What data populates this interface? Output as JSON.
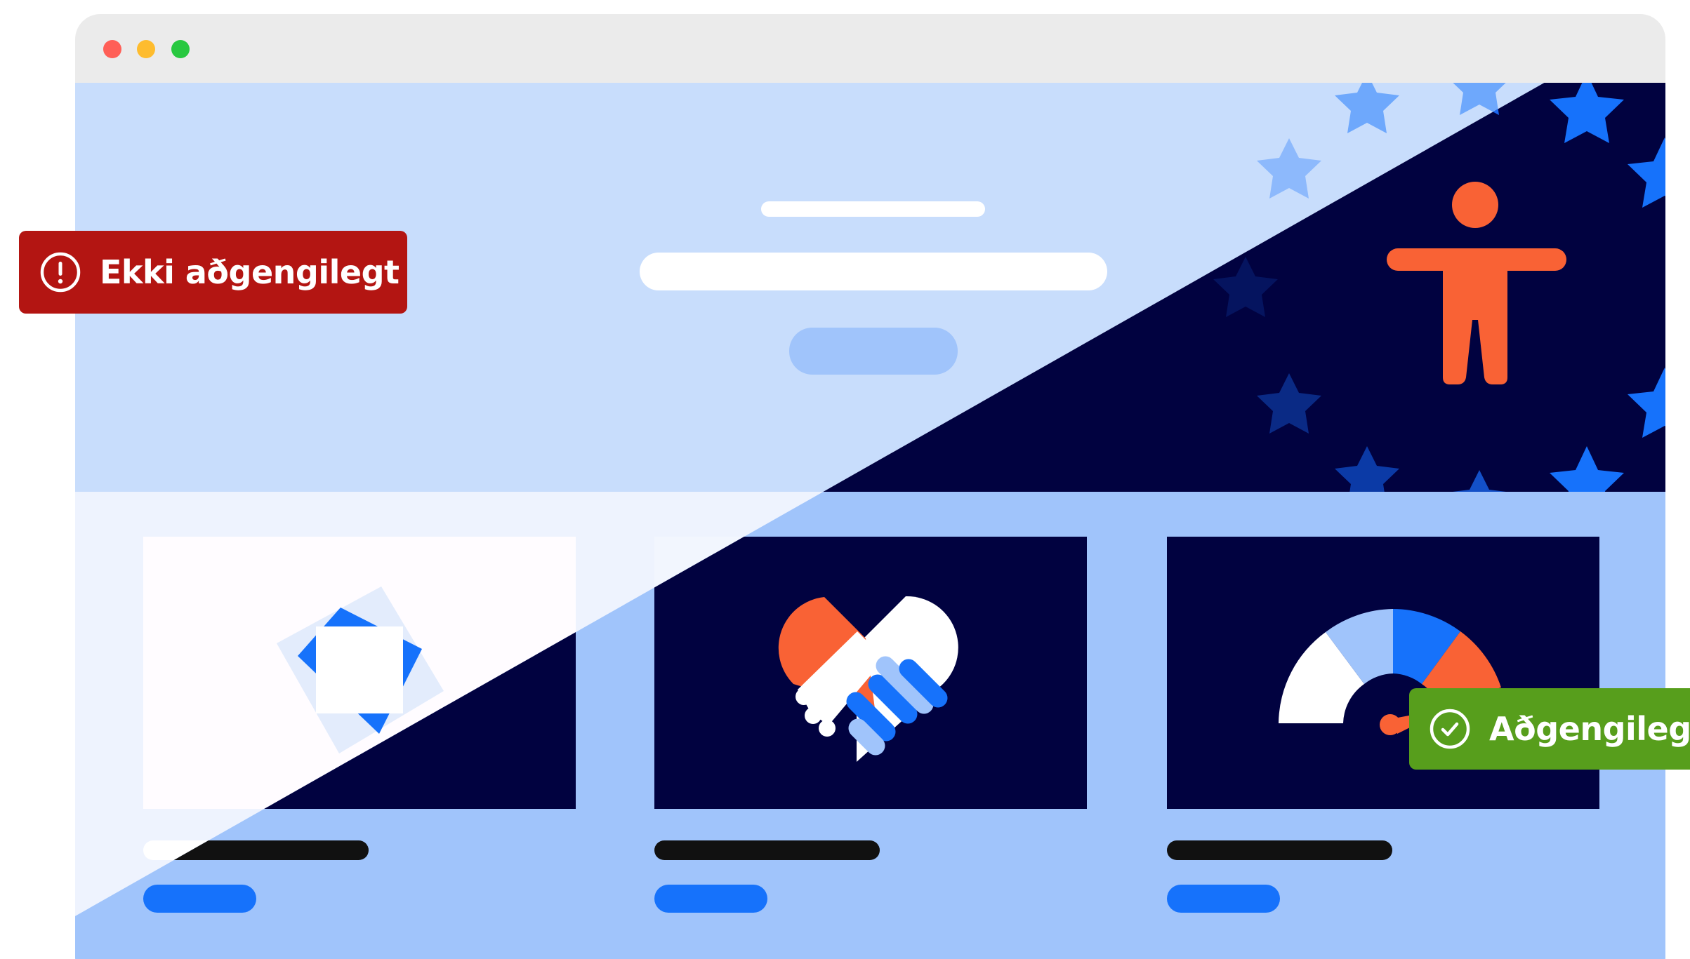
{
  "window": {
    "traffic_lights": [
      {
        "name": "close",
        "color": "#ff5f57"
      },
      {
        "name": "minimize",
        "color": "#febc2e"
      },
      {
        "name": "zoom",
        "color": "#28c840"
      }
    ]
  },
  "badges": {
    "inaccessible": {
      "label": "Ekki aðgengilegt",
      "icon": "exclamation-circle-icon",
      "color": "#b31512"
    },
    "accessible": {
      "label": "Aðgengilegt",
      "icon": "check-circle-icon",
      "color": "#579e1c"
    }
  },
  "hero": {
    "icon": "accessibility-person-icon",
    "stars_icon": "eu-stars-icon"
  },
  "cards": [
    {
      "name": "abstract-shapes",
      "icon": "overlapping-squares-icon"
    },
    {
      "name": "partnership",
      "icon": "handshake-heart-icon"
    },
    {
      "name": "performance",
      "icon": "gauge-icon"
    }
  ],
  "colors": {
    "light_background": "#c8ddfc",
    "light_content": "#eef3fe",
    "dark_background": "#010240",
    "accent_blue": "#1672fb",
    "accent_orange": "#f96235",
    "content_background": "#a0c4fb",
    "chrome_bar": "#ebebeb"
  }
}
